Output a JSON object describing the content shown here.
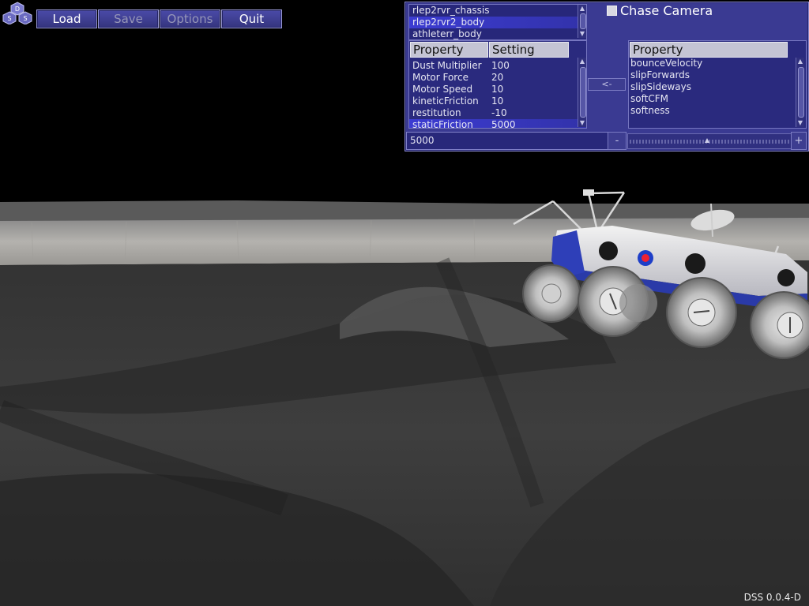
{
  "toolbar": {
    "logo_letters": [
      "D",
      "S",
      "S"
    ],
    "buttons": [
      {
        "label": "Load",
        "enabled": true
      },
      {
        "label": "Save",
        "enabled": false
      },
      {
        "label": "Options",
        "enabled": false
      },
      {
        "label": "Quit",
        "enabled": true
      }
    ]
  },
  "panel": {
    "bodies": [
      "rlep2rvr_chassis",
      "rlep2rvr2_body",
      "athleterr_body"
    ],
    "selected_body": "rlep2rvr2_body",
    "chase_camera_label": "Chase Camera",
    "chase_camera_checked": false,
    "left_headers": {
      "property": "Property",
      "setting": "Setting"
    },
    "properties": [
      {
        "name": "Dust Multiplier",
        "value": "100"
      },
      {
        "name": "Motor Force",
        "value": "20"
      },
      {
        "name": "Motor Speed",
        "value": "10"
      },
      {
        "name": "kineticFriction",
        "value": "10"
      },
      {
        "name": "restitution",
        "value": "-10"
      },
      {
        "name": "staticFriction",
        "value": "5000"
      }
    ],
    "selected_property": "staticFriction",
    "move_button_label": "<-",
    "right_header": "Property",
    "available_properties": [
      "bounceVelocity",
      "slipForwards",
      "slipSideways",
      "softCFM",
      "softness"
    ],
    "value_input": "5000",
    "minus_label": "-",
    "plus_label": "+"
  },
  "status": {
    "version": "DSS 0.0.4-D"
  },
  "colors": {
    "panel_bg": "#3a3a92",
    "selection": "#3c3cd2",
    "header_bg": "#c4c4d4",
    "button_bg": "#4a4aa8"
  }
}
